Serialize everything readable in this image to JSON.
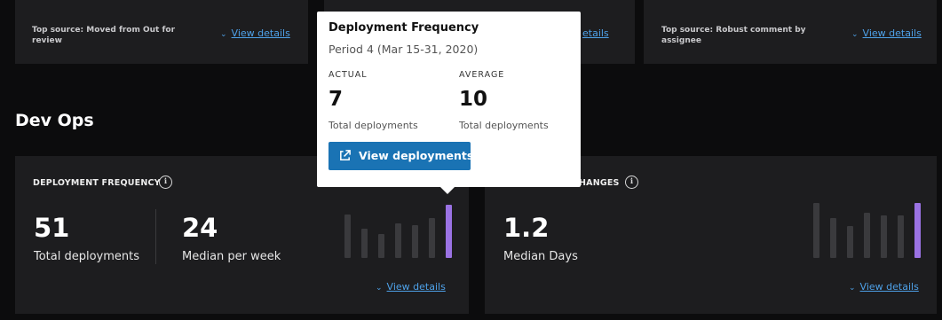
{
  "top_row": {
    "card1": {
      "source": "Top source: Moved from Out for review",
      "link": "View details"
    },
    "card2": {
      "link_partial": "etails"
    },
    "card3": {
      "source": "Top source: Robust comment by assignee",
      "link": "View details"
    }
  },
  "section": {
    "title": "Dev Ops"
  },
  "deploy_card": {
    "label": "DEPLOYMENT FREQUENCY",
    "metric1": {
      "value": "51",
      "label": "Total deployments"
    },
    "metric2": {
      "value": "24",
      "label": "Median per week"
    },
    "bars": [
      0.82,
      0.55,
      0.45,
      0.65,
      0.62,
      0.75,
      1.0
    ],
    "link": "View details"
  },
  "changes_card": {
    "label_partial": "HANGES",
    "metric": {
      "value": "1.2",
      "label": "Median Days"
    },
    "bars": [
      1.0,
      0.72,
      0.58,
      0.82,
      0.78,
      0.78,
      1.0
    ],
    "link": "View details"
  },
  "tooltip": {
    "title": "Deployment Frequency",
    "period": "Period 4 (Mar 15-31, 2020)",
    "actual_caption": "ACTUAL",
    "actual_value": "7",
    "actual_label": "Total deployments",
    "average_caption": "AVERAGE",
    "average_value": "10",
    "average_label": "Total deployments",
    "button": "View deployments"
  },
  "colors": {
    "background": "#0c0c0d",
    "card": "#1d1d1f",
    "link": "#4ea1e8",
    "bar": "#3a3a3d",
    "highlight_bar": "#9a72e3",
    "button": "#1a73b4"
  },
  "icons": [
    "chevron-down-icon",
    "info-icon",
    "external-link-icon"
  ]
}
